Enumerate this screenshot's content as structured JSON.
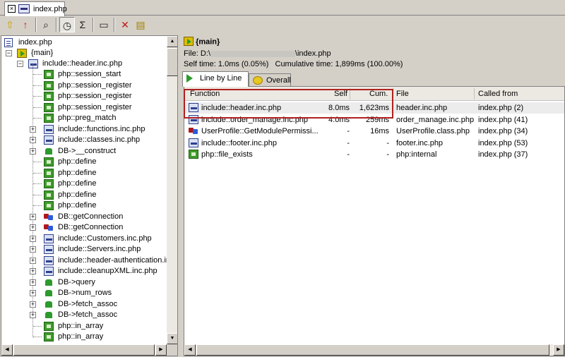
{
  "document_tab": {
    "label": "index.php",
    "close_glyph": "×"
  },
  "toolbar": {
    "buttons": [
      {
        "name": "go-up-icon",
        "glyph": "⇧",
        "color": "#c8a000"
      },
      {
        "name": "red-arrow-up-icon",
        "glyph": "↑",
        "color": "#d02020"
      },
      {
        "name": "binoculars-icon",
        "glyph": "⌕",
        "color": "#202020"
      },
      {
        "name": "stopwatch-icon",
        "glyph": "◷",
        "color": "#202020"
      },
      {
        "name": "sigma-icon",
        "glyph": "Σ",
        "color": "#202020"
      },
      {
        "name": "film-icon",
        "glyph": "▭",
        "color": "#202020"
      },
      {
        "name": "close-red-x-icon",
        "glyph": "✕",
        "color": "#c01818"
      },
      {
        "name": "notes-icon",
        "glyph": "▤",
        "color": "#a08000"
      }
    ]
  },
  "tree": {
    "root": "index.php",
    "main": "{main}",
    "header_inc": "include::header.inc.php",
    "children": [
      {
        "label": "php::session_start",
        "icon": "php"
      },
      {
        "label": "php::session_register",
        "icon": "php"
      },
      {
        "label": "php::session_register",
        "icon": "php"
      },
      {
        "label": "php::session_register",
        "icon": "php"
      },
      {
        "label": "php::preg_match",
        "icon": "php"
      },
      {
        "label": "include::functions.inc.php",
        "icon": "inc",
        "expander": "+"
      },
      {
        "label": "include::classes.inc.php",
        "icon": "inc",
        "expander": "+"
      },
      {
        "label": "DB->__construct",
        "icon": "db",
        "expander": "+"
      },
      {
        "label": "php::define",
        "icon": "php"
      },
      {
        "label": "php::define",
        "icon": "php"
      },
      {
        "label": "php::define",
        "icon": "php"
      },
      {
        "label": "php::define",
        "icon": "php"
      },
      {
        "label": "php::define",
        "icon": "php"
      },
      {
        "label": "DB::getConnection",
        "icon": "cls",
        "expander": "+"
      },
      {
        "label": "DB::getConnection",
        "icon": "cls",
        "expander": "+"
      },
      {
        "label": "include::Customers.inc.php",
        "icon": "inc",
        "expander": "+"
      },
      {
        "label": "include::Servers.inc.php",
        "icon": "inc",
        "expander": "+"
      },
      {
        "label": "include::header-authentication.inc",
        "icon": "inc",
        "expander": "+"
      },
      {
        "label": "include::cleanupXML.inc.php",
        "icon": "inc",
        "expander": "+"
      },
      {
        "label": "DB->query",
        "icon": "db",
        "expander": "+"
      },
      {
        "label": "DB->num_rows",
        "icon": "db",
        "expander": "+"
      },
      {
        "label": "DB->fetch_assoc",
        "icon": "db",
        "expander": "+"
      },
      {
        "label": "DB->fetch_assoc",
        "icon": "db",
        "expander": "+"
      },
      {
        "label": "php::in_array",
        "icon": "php"
      },
      {
        "label": "php::in_array",
        "icon": "php"
      }
    ]
  },
  "detail": {
    "title": "{main}",
    "file_prefix": "File: D:\\",
    "file_suffix": "\\index.php",
    "self_time": "Self time: 1.0ms (0.05%)",
    "cumulative_time": "Cumulative time: 1,899ms (100.00%)",
    "tabs": [
      {
        "label": "Line by Line"
      },
      {
        "label": "Overall"
      }
    ],
    "columns": [
      "Function",
      "Self",
      "Cum.",
      "File",
      "Called from"
    ],
    "rows": [
      {
        "function": "include::header.inc.php",
        "icon": "inc",
        "self": "8.0ms",
        "cum": "1,623ms",
        "file": "header.inc.php",
        "called_from": "index.php (2)"
      },
      {
        "function": "include::order_manage.inc.php",
        "icon": "inc",
        "self": "4.0ms",
        "cum": "259ms",
        "file": "order_manage.inc.php",
        "called_from": "index.php (41)"
      },
      {
        "function": "UserProfile::GetModulePermissi...",
        "icon": "cls",
        "self": "-",
        "cum": "16ms",
        "file": "UserProfile.class.php",
        "called_from": "index.php (34)"
      },
      {
        "function": "include::footer.inc.php",
        "icon": "inc",
        "self": "-",
        "cum": "-",
        "file": "footer.inc.php",
        "called_from": "index.php (53)"
      },
      {
        "function": "php::file_exists",
        "icon": "php",
        "self": "-",
        "cum": "-",
        "file": "php:internal",
        "called_from": "index.php (37)"
      }
    ]
  }
}
